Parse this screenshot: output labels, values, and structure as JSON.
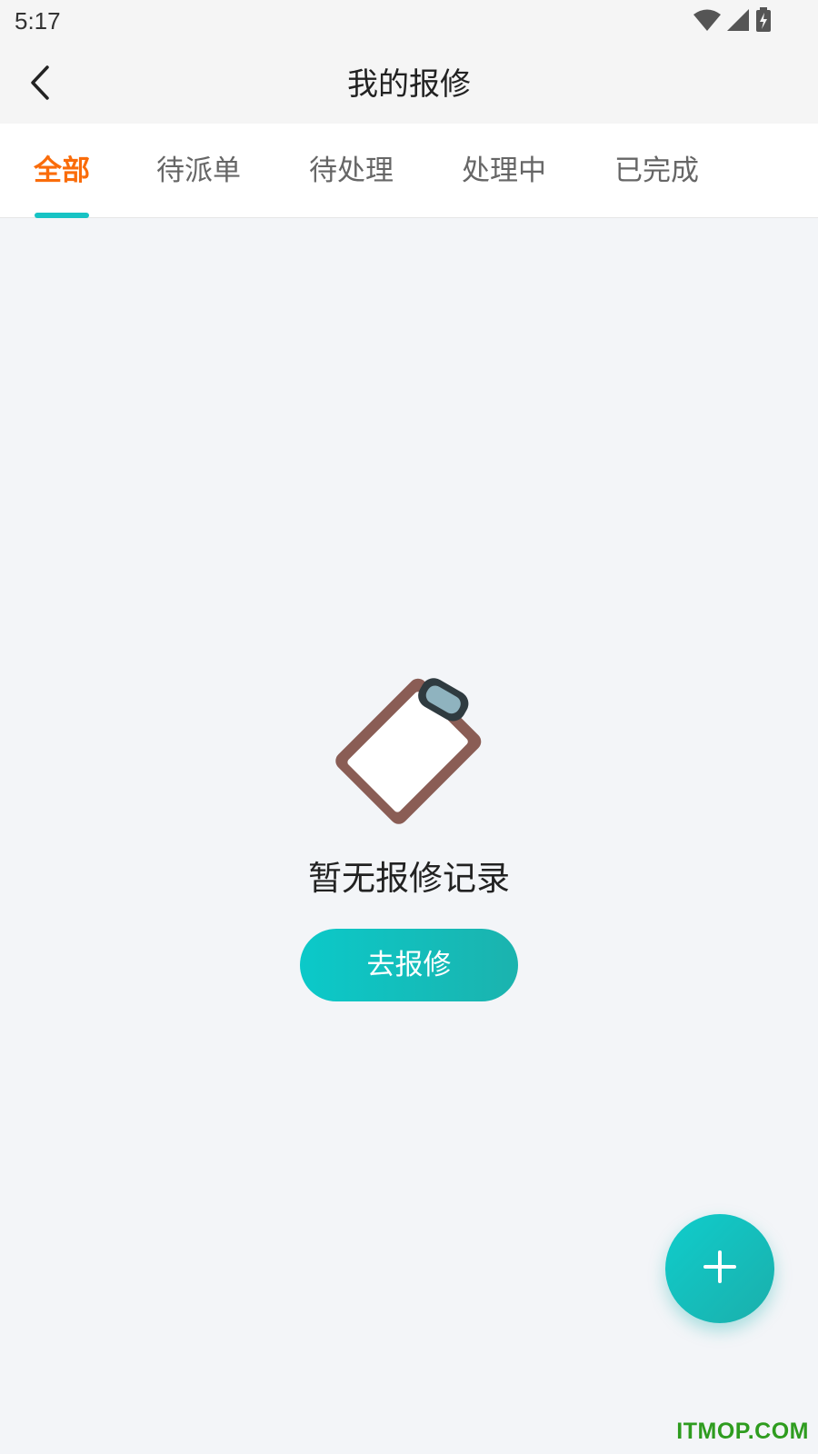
{
  "status_bar": {
    "time": "5:17",
    "icons": [
      "wifi-icon",
      "signal-icon",
      "battery-charging-icon"
    ]
  },
  "header": {
    "title": "我的报修",
    "back_icon": "chevron-left-icon"
  },
  "tabs": [
    {
      "label": "全部",
      "active": true
    },
    {
      "label": "待派单",
      "active": false
    },
    {
      "label": "待处理",
      "active": false
    },
    {
      "label": "处理中",
      "active": false
    },
    {
      "label": "已完成",
      "active": false
    }
  ],
  "empty_state": {
    "illustration": "clipboard-icon",
    "message": "暂无报修记录",
    "action_label": "去报修"
  },
  "fab": {
    "icon": "plus-icon"
  },
  "watermark": "ITMOP.COM",
  "colors": {
    "accent_teal": "#17c3c4",
    "active_tab": "#fa6c0a",
    "background": "#f3f5f8",
    "watermark": "#2e9c1f"
  }
}
